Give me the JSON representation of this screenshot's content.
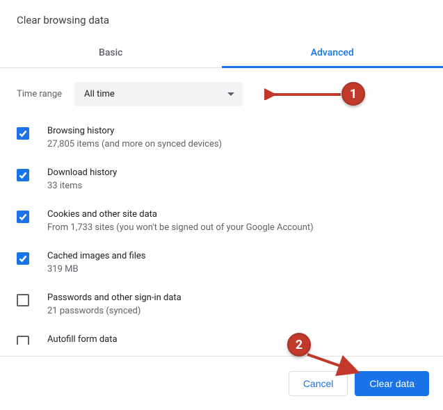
{
  "title": "Clear browsing data",
  "tabs": {
    "basic": "Basic",
    "advanced": "Advanced"
  },
  "timerange": {
    "label": "Time range",
    "value": "All time"
  },
  "items": [
    {
      "title": "Browsing history",
      "sub": "27,805 items (and more on synced devices)",
      "checked": true
    },
    {
      "title": "Download history",
      "sub": "33 items",
      "checked": true
    },
    {
      "title": "Cookies and other site data",
      "sub": "From 1,733 sites (you won't be signed out of your Google Account)",
      "checked": true
    },
    {
      "title": "Cached images and files",
      "sub": "319 MB",
      "checked": true
    },
    {
      "title": "Passwords and other sign-in data",
      "sub": "21 passwords (synced)",
      "checked": false
    },
    {
      "title": "Autofill form data",
      "sub": "",
      "checked": false
    }
  ],
  "buttons": {
    "cancel": "Cancel",
    "clear": "Clear data"
  },
  "annotations": {
    "one": "1",
    "two": "2"
  }
}
